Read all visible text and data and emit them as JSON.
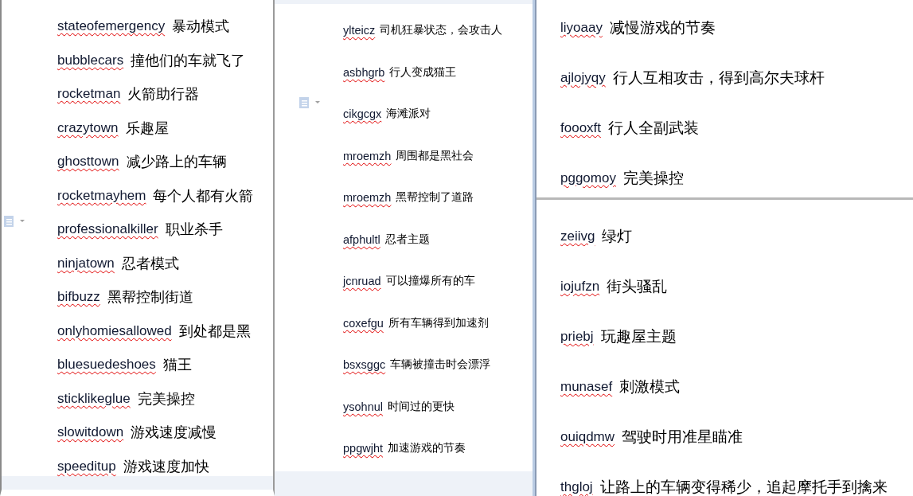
{
  "panels": [
    {
      "paste_options": true,
      "pages": [
        {
          "entries": [
            {
              "code": "stateofemergency",
              "effect": "暴动模式"
            },
            {
              "code": "bubblecars",
              "effect": "撞他们的车就飞了"
            },
            {
              "code": "rocketman",
              "effect": "火箭助行器"
            },
            {
              "code": "crazytown",
              "effect": "乐趣屋"
            },
            {
              "code": "ghosttown",
              "effect": "减少路上的车辆"
            },
            {
              "code": "rocketmayhem",
              "effect": "每个人都有火箭"
            },
            {
              "code": "professionalkiller",
              "effect": "职业杀手"
            },
            {
              "code": "ninjatown",
              "effect": "忍者模式"
            },
            {
              "code": "bifbuzz",
              "effect": "黑帮控制街道"
            },
            {
              "code": "onlyhomiesallowed",
              "effect": "到处都是黑"
            },
            {
              "code": "bluesuedeshoes",
              "effect": "猫王"
            },
            {
              "code": "sticklikeglue",
              "effect": "完美操控"
            },
            {
              "code": "slowitdown",
              "effect": "游戏速度减慢"
            },
            {
              "code": "speeditup",
              "effect": "游戏速度加快"
            }
          ]
        }
      ]
    },
    {
      "paste_options": true,
      "pages": [
        {
          "entries": [
            {
              "code": "ylteicz",
              "effect": "司机狂暴状态，会攻击人"
            },
            {
              "code": "asbhgrb",
              "effect": "行人变成猫王"
            },
            {
              "code": "cikgcgx",
              "effect": "海滩派对"
            },
            {
              "code": "mroemzh",
              "effect": "周围都是黑社会"
            },
            {
              "code": "mroemzh",
              "effect": "黑帮控制了道路"
            },
            {
              "code": "afphultl",
              "effect": "忍者主题"
            },
            {
              "code": "jcnruad",
              "effect": "可以撞爆所有的车"
            },
            {
              "code": "coxefgu",
              "effect": "所有车辆得到加速剂"
            },
            {
              "code": "bsxsggc",
              "effect": "车辆被撞击时会漂浮"
            },
            {
              "code": "ysohnul",
              "effect": "时间过的更快"
            },
            {
              "code": "ppgwjht",
              "effect": "加速游戏的节奏"
            }
          ]
        }
      ]
    },
    {
      "pages": [
        {
          "entries": [
            {
              "code": "liyoaay",
              "effect": "减慢游戏的节奏"
            },
            {
              "code": "ajlojyqy",
              "effect": "行人互相攻击，得到高尔夫球杆"
            },
            {
              "code": "foooxft",
              "effect": "行人全副武装"
            },
            {
              "code": "pggomoy",
              "effect": "完美操控"
            }
          ]
        },
        {
          "entries": [
            {
              "code": "zeiivg",
              "effect": "绿灯"
            },
            {
              "code": "iojufzn",
              "effect": "街头骚乱"
            },
            {
              "code": "priebj",
              "effect": "玩趣屋主题"
            },
            {
              "code": "munasef",
              "effect": "刺激模式"
            },
            {
              "code": "ouiqdmw",
              "effect": "驾驶时用准星瞄准"
            },
            {
              "code": "thgloj",
              "effect": "让路上的车辆变得稀少，追起摩托手到擒来"
            }
          ]
        }
      ]
    }
  ]
}
